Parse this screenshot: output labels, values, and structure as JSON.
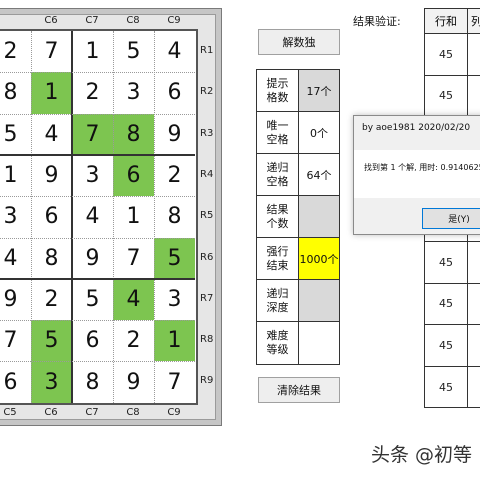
{
  "sudoku": {
    "rows": [
      [
        2,
        7,
        1,
        5,
        4
      ],
      [
        8,
        1,
        2,
        3,
        6
      ],
      [
        5,
        4,
        7,
        8,
        9
      ],
      [
        1,
        9,
        3,
        6,
        2
      ],
      [
        3,
        6,
        4,
        1,
        8
      ],
      [
        4,
        8,
        9,
        7,
        5
      ],
      [
        9,
        2,
        5,
        4,
        3
      ],
      [
        7,
        5,
        6,
        2,
        1
      ],
      [
        6,
        3,
        8,
        9,
        7
      ]
    ],
    "green_cells": [
      [
        1,
        1
      ],
      [
        2,
        2
      ],
      [
        2,
        3
      ],
      [
        3,
        3
      ],
      [
        5,
        4
      ],
      [
        6,
        3
      ],
      [
        7,
        1
      ],
      [
        7,
        4
      ],
      [
        8,
        1
      ]
    ],
    "col_labels_bottom": [
      "C5",
      "C6",
      "C7",
      "C8",
      "C9"
    ],
    "col_labels_top": [
      "C6",
      "C7",
      "C8",
      "C9"
    ],
    "row_labels": [
      "R1",
      "R2",
      "R3",
      "R4",
      "R5",
      "R6",
      "R7",
      "R8",
      "R9"
    ],
    "green_color": "#7dc550"
  },
  "panel": {
    "solve_button": "解数独",
    "clear_button": "清除结果",
    "info_rows": [
      {
        "label": "提示格数",
        "value": "17个"
      },
      {
        "label": "唯一空格",
        "value": "0个"
      },
      {
        "label": "递归空格",
        "value": "64个"
      },
      {
        "label": "结果个数",
        "value": ""
      },
      {
        "label": "强行结束",
        "value": "1000个"
      },
      {
        "label": "递归深度",
        "value": ""
      },
      {
        "label": "难度等级",
        "value": ""
      }
    ]
  },
  "verify": {
    "label": "结果验证:",
    "header_col1": "行和",
    "header_col2": "列",
    "row_sums": [
      "45",
      "45",
      "45",
      "45",
      "45",
      "45",
      "45",
      "45",
      "45"
    ]
  },
  "dialog": {
    "title": "by aoe1981 2020/02/20",
    "message": "找到第 1 个解, 用时: 0.9140625",
    "yes_button": "是(Y)"
  },
  "watermark": "头条 @初等"
}
